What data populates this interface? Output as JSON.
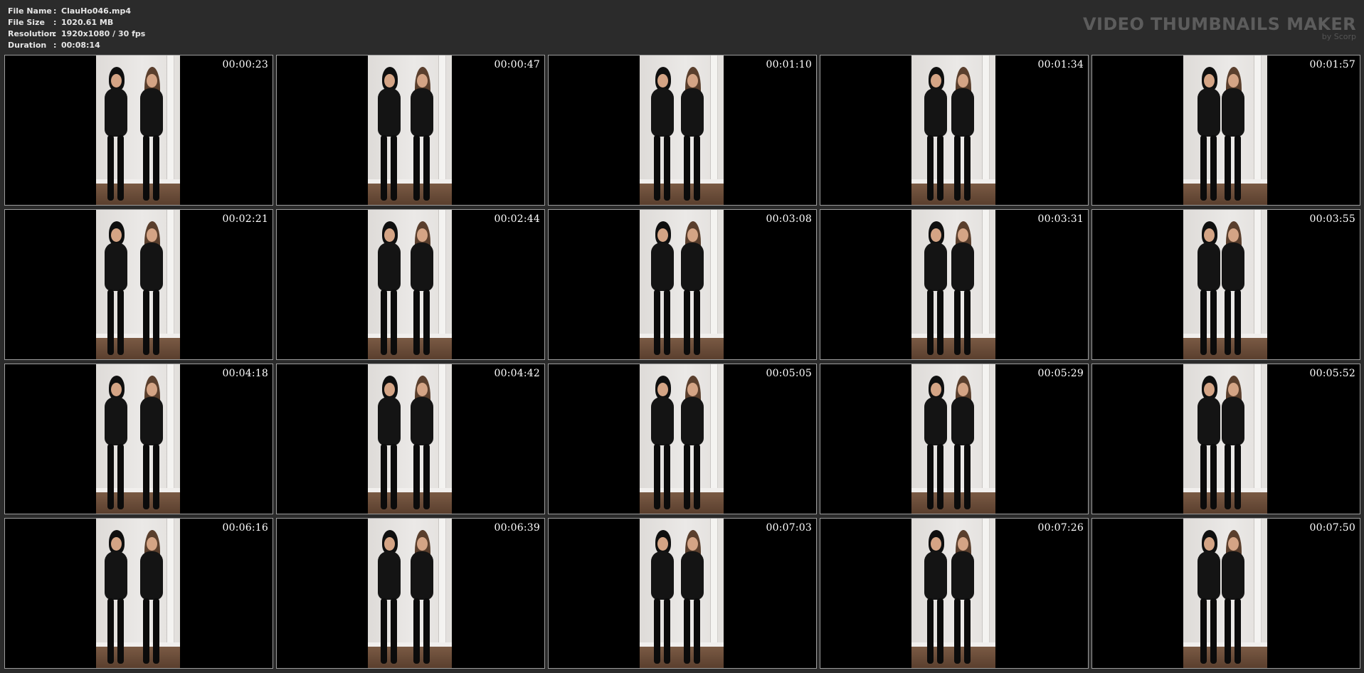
{
  "info": {
    "file_name": {
      "label": "File Name",
      "value": "ClauHo046.mp4"
    },
    "file_size": {
      "label": "File Size",
      "value": "1020.61 MB"
    },
    "resolution": {
      "label": "Resolution",
      "value": "1920x1080 / 30 fps"
    },
    "duration": {
      "label": "Duration",
      "value": "00:08:14"
    },
    "separator": ":"
  },
  "brand": {
    "title": "VIDEO THUMBNAILS MAKER",
    "subtitle": "by Scorp"
  },
  "thumbnails": [
    "00:00:23",
    "00:00:47",
    "00:01:10",
    "00:01:34",
    "00:01:57",
    "00:02:21",
    "00:02:44",
    "00:03:08",
    "00:03:31",
    "00:03:55",
    "00:04:18",
    "00:04:42",
    "00:05:05",
    "00:05:29",
    "00:05:52",
    "00:06:16",
    "00:06:39",
    "00:07:03",
    "00:07:26",
    "00:07:50"
  ],
  "colors": {
    "background": "#2b2b2b",
    "info_text": "#e6e6e6",
    "brand_text": "#5c5c5c",
    "thumb_border": "#9c9c9c"
  }
}
